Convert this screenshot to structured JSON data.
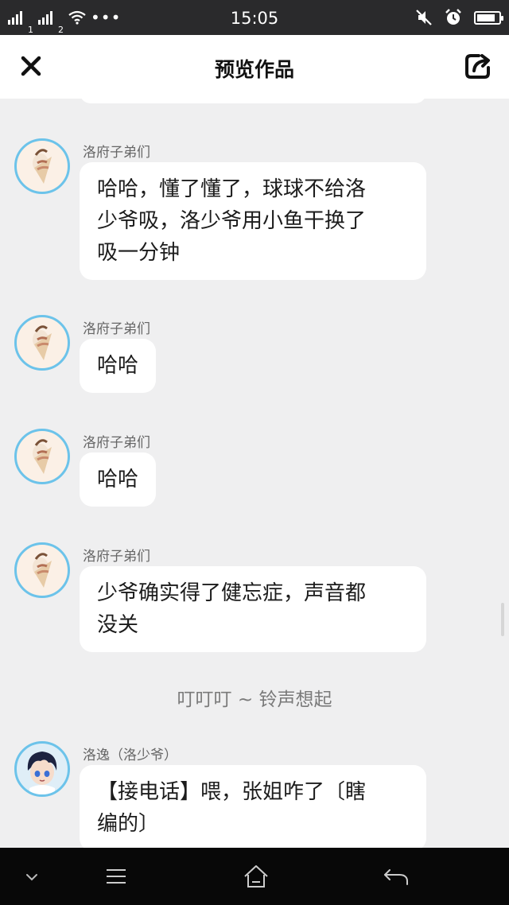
{
  "status_bar": {
    "sim1_label": "1",
    "sim2_label": "2",
    "more_dots": "•••",
    "time": "15:05",
    "battery_level_percent": 85
  },
  "header": {
    "title": "预览作品",
    "close_icon": "close-icon",
    "share_icon": "share-icon"
  },
  "messages": [
    {
      "sender": "洛府子弟们",
      "text": "哈哈，懂了懂了，球球不给洛\n少爷吸，洛少爷用小鱼干换了\n吸一分钟",
      "avatar": "ice-cream-avatar"
    },
    {
      "sender": "洛府子弟们",
      "text": "哈哈",
      "avatar": "ice-cream-avatar"
    },
    {
      "sender": "洛府子弟们",
      "text": "哈哈",
      "avatar": "ice-cream-avatar"
    },
    {
      "sender": "洛府子弟们",
      "text": "少爷确实得了健忘症，声音都\n没关",
      "avatar": "ice-cream-avatar"
    },
    {
      "sender": "洛逸（洛少爷）",
      "text": "【接电话】喂，张姐咋了〔瞎\n编的〕",
      "avatar": "anime-boy-avatar"
    }
  ],
  "system_note": "叮叮叮 ~ 铃声想起",
  "nav_bar": {
    "icons": [
      "chevron-down-icon",
      "menu-icon",
      "home-icon",
      "back-icon"
    ]
  },
  "colors": {
    "background": "#efeff0",
    "bubble": "#ffffff",
    "avatar_ring": "#6cc3ea",
    "status_bar": "#2a2a2c",
    "nav_bar": "#080808"
  }
}
